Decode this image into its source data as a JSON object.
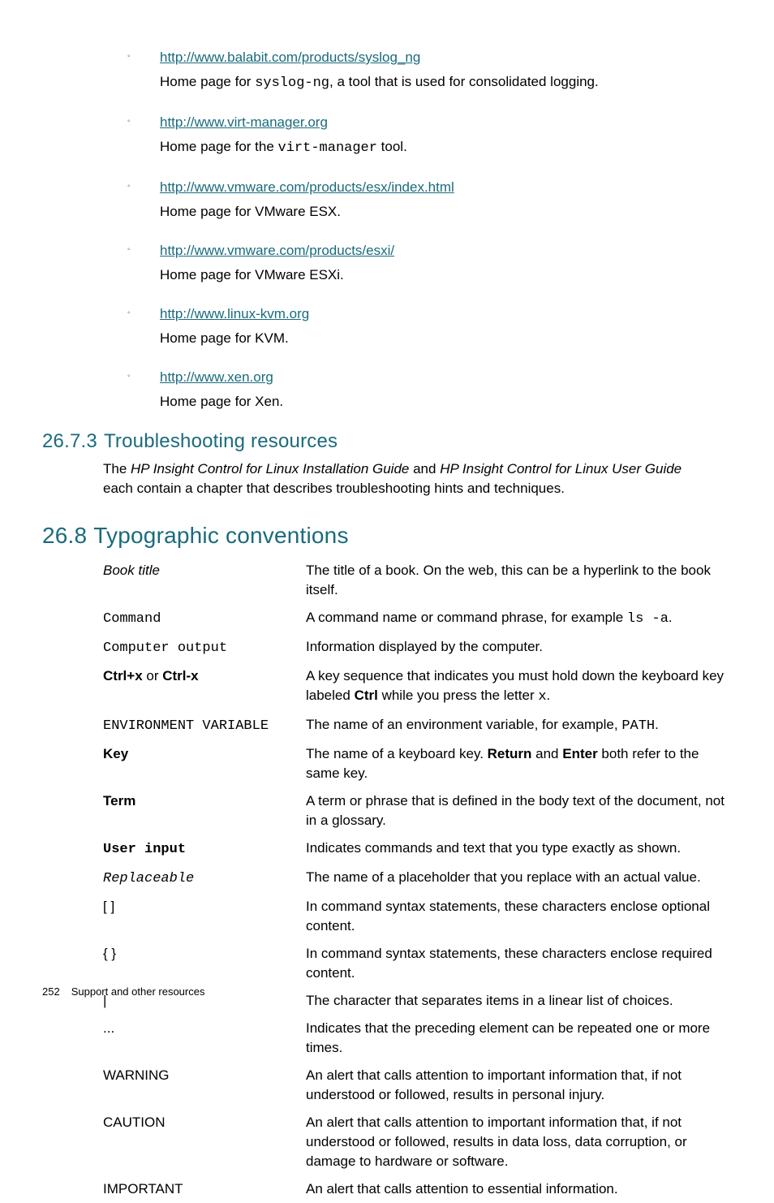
{
  "bullets": [
    {
      "url": "http://www.balabit.com/products/syslog_ng",
      "desc_pre": "Home page for ",
      "desc_code": "syslog-ng",
      "desc_post": ", a tool that is used for consolidated logging."
    },
    {
      "url": "http://www.virt-manager.org",
      "desc_pre": "Home page for the ",
      "desc_code": "virt-manager",
      "desc_post": " tool."
    },
    {
      "url": "http://www.vmware.com/products/esx/index.html",
      "desc_pre": "Home page for VMware ESX.",
      "desc_code": "",
      "desc_post": ""
    },
    {
      "url": "http://www.vmware.com/products/esxi/",
      "desc_pre": "Home page for VMware ESXi.",
      "desc_code": "",
      "desc_post": ""
    },
    {
      "url": "http://www.linux-kvm.org",
      "desc_pre": "Home page for KVM.",
      "desc_code": "",
      "desc_post": ""
    },
    {
      "url": "http://www.xen.org",
      "desc_pre": "Home page for Xen.",
      "desc_code": "",
      "desc_post": ""
    }
  ],
  "sec273": {
    "num": "26.7.3",
    "title": "Troubleshooting resources",
    "p1": "The ",
    "i1": "HP Insight Control for Linux Installation Guide",
    "p2": " and ",
    "i2": "HP Insight Control for Linux User Guide",
    "p3": "each contain a chapter that describes troubleshooting hints and techniques."
  },
  "sec268": {
    "num": "26.8",
    "title": "Typographic conventions"
  },
  "conv": [
    {
      "termHtml": "<span class='ital'>Book title</span>",
      "def": "The title of a book. On the web, this can be a hyperlink to the book itself."
    },
    {
      "termHtml": "<span class='mono'>Command</span>",
      "def": "A command name or command phrase, for example <span class='mono'>ls -a</span>."
    },
    {
      "termHtml": "<span class='mono'>Computer output</span>",
      "def": "Information displayed by the computer."
    },
    {
      "termHtml": "<span class='bold'>Ctrl+x</span> or <span class='bold'>Ctrl-x</span>",
      "def": "A key sequence that indicates you must hold down the keyboard key labeled <span class='bold'>Ctrl</span> while you press the letter <span class='mono'>x</span>."
    },
    {
      "termHtml": "<span class='mono'>ENVIRONMENT VARIABLE</span>",
      "def": "The name of an environment variable, for example, <span class='mono'>PATH</span>."
    },
    {
      "termHtml": "<span class='bold'>Key</span>",
      "def": "The name of a keyboard key. <span class='bold'>Return</span> and <span class='bold'>Enter</span> both refer to the same key."
    },
    {
      "termHtml": "<span class='bold'>Term</span>",
      "def": "A term or phrase that is defined in the body text of the document, not in a glossary."
    },
    {
      "termHtml": "<span class='mono bold'>User input</span>",
      "def": "Indicates commands and text that you type exactly as shown."
    },
    {
      "termHtml": "<span class='mono ital'>Replaceable</span>",
      "def": "The name of a placeholder that you replace with an actual value."
    },
    {
      "termHtml": "[ ]",
      "def": "In command syntax statements, these characters enclose optional content."
    },
    {
      "termHtml": "{ }",
      "def": "In command syntax statements, these characters enclose required content."
    },
    {
      "termHtml": "|",
      "def": "The character that separates items in a linear list of choices."
    },
    {
      "termHtml": "...",
      "def": "Indicates that the preceding element can be repeated one or more times."
    },
    {
      "termHtml": "WARNING",
      "def": "An alert that calls attention to important information that, if not understood or followed, results in personal injury."
    },
    {
      "termHtml": "CAUTION",
      "def": "An alert that calls attention to important information that, if not understood or followed, results in data loss, data corruption, or damage to hardware or software."
    },
    {
      "termHtml": "IMPORTANT",
      "def": "An alert that calls attention to essential information."
    }
  ],
  "footer": {
    "page": "252",
    "title": "Support and other resources"
  }
}
